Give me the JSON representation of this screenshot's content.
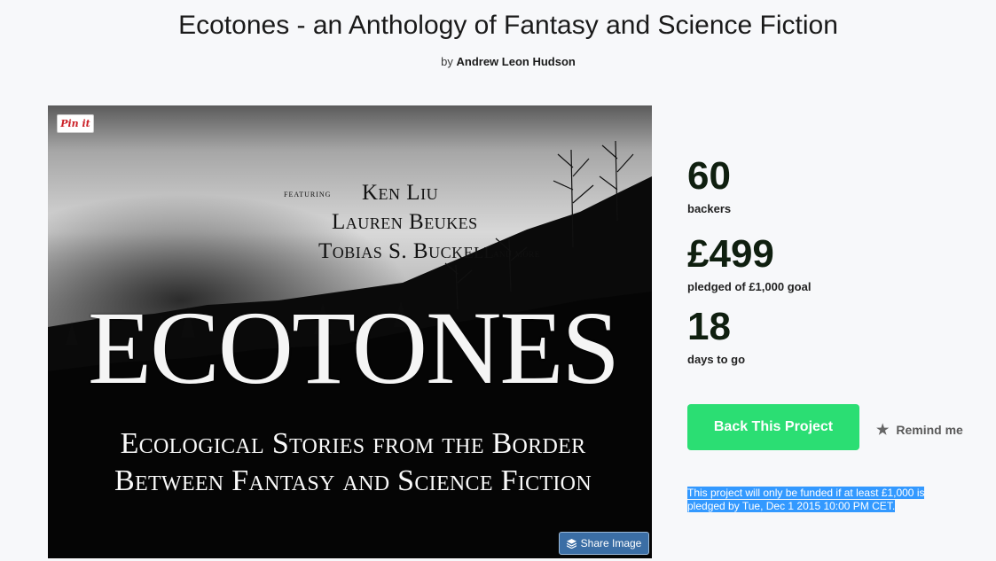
{
  "header": {
    "title": "Ecotones - an Anthology of Fantasy and Science Fiction",
    "by_prefix": "by",
    "author": "Andrew Leon Hudson"
  },
  "hero": {
    "pin_label": "Pin it",
    "featuring_label": "featuring",
    "featured_authors": [
      "Ken Liu",
      "Lauren Beukes",
      "Tobias S. Buckell"
    ],
    "and_more": "and more",
    "book_title": "ECOTONES",
    "subtitle_lines": [
      "Ecological Stories from the Border",
      "Between Fantasy and Science Fiction"
    ],
    "share_label": "Share Image"
  },
  "stats": {
    "backers_count": "60",
    "backers_label": "backers",
    "pledged_amount": "£499",
    "pledged_label": "pledged of £1,000 goal",
    "days_count": "18",
    "days_label": "days to go"
  },
  "actions": {
    "back_label": "Back This Project",
    "remind_label": "Remind me"
  },
  "funding_note": {
    "line1": "This project will only be funded if at least £1,000 is",
    "line2": "pledged by Tue, Dec 1 2015 10:00 PM CET."
  },
  "colors": {
    "back_button": "#2bde73",
    "selection_highlight": "#3399ff",
    "share_button": "#3b6ea5"
  }
}
